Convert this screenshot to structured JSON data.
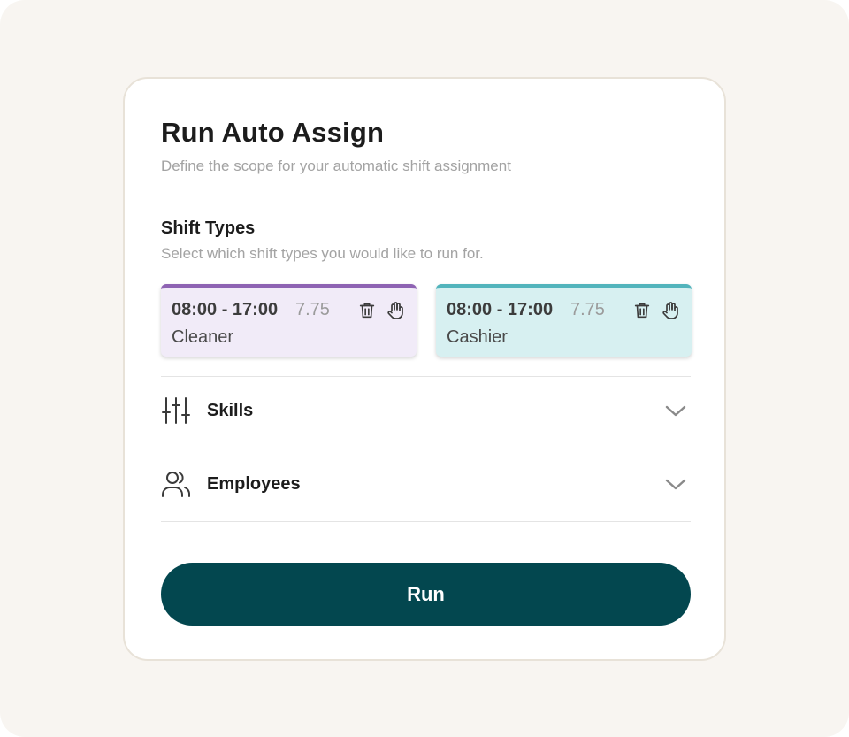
{
  "dialog": {
    "title": "Run Auto Assign",
    "subtitle": "Define the scope for your automatic shift assignment"
  },
  "shift_types": {
    "title": "Shift Types",
    "description": "Select which shift types you would like to run for.",
    "items": [
      {
        "time": "08:00 - 17:00",
        "hours": "7.75",
        "name": "Cleaner",
        "accent": "#8e63b3",
        "background": "#f1ebf8",
        "icons": [
          "trash-icon",
          "hand-icon"
        ]
      },
      {
        "time": "08:00 - 17:00",
        "hours": "7.75",
        "name": "Cashier",
        "accent": "#52b4bc",
        "background": "#d7f0f1",
        "icons": [
          "trash-icon",
          "hand-icon"
        ]
      }
    ]
  },
  "filters": [
    {
      "label": "Skills",
      "icon": "sliders-icon",
      "expanded": false
    },
    {
      "label": "Employees",
      "icon": "users-icon",
      "expanded": false
    }
  ],
  "actions": {
    "run_label": "Run",
    "run_color": "#03474f"
  }
}
